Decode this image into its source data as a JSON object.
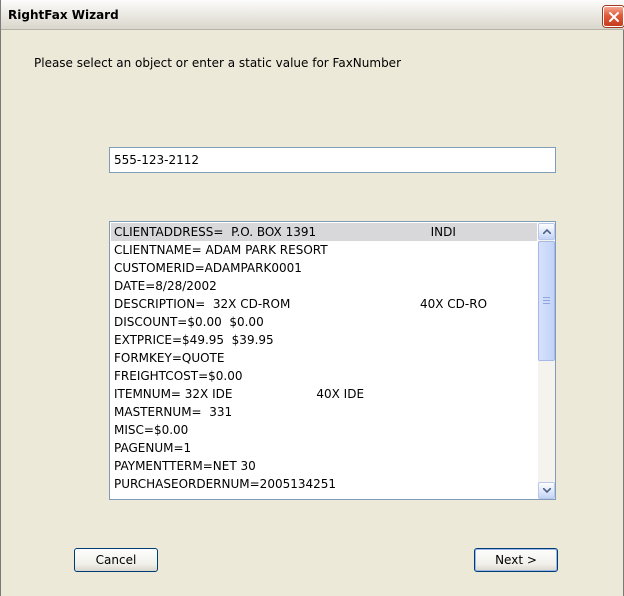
{
  "window": {
    "title": "RightFax Wizard"
  },
  "prompt": "Please select an object or enter a static value for FaxNumber",
  "value_input": {
    "value": "555-123-2112"
  },
  "list": {
    "items": [
      "CLIENTADDRESS=  P.O. BOX 1391                              INDI",
      "CLIENTNAME= ADAM PARK RESORT",
      "CUSTOMERID=ADAMPARK0001",
      "DATE=8/28/2002",
      "DESCRIPTION=  32X CD-ROM                                  40X CD-RO",
      "DISCOUNT=$0.00  $0.00",
      "EXTPRICE=$49.95  $39.95",
      "FORMKEY=QUOTE",
      "FREIGHTCOST=$0.00",
      "ITEMNUM= 32X IDE                      40X IDE",
      "MASTERNUM=  331",
      "MISC=$0.00",
      "PAGENUM=1",
      "PAYMENTTERM=NET 30",
      "PURCHASEORDERNUM=2005134251"
    ],
    "selected_index": 0
  },
  "buttons": {
    "cancel": "Cancel",
    "next": "Next >"
  },
  "icons": {
    "close": "close-icon",
    "scroll_up": "chevron-up-icon",
    "scroll_down": "chevron-down-icon"
  },
  "colors": {
    "selection": "#d8d8da",
    "close_button": "#e05a3a",
    "field_border": "#7f9db9"
  }
}
